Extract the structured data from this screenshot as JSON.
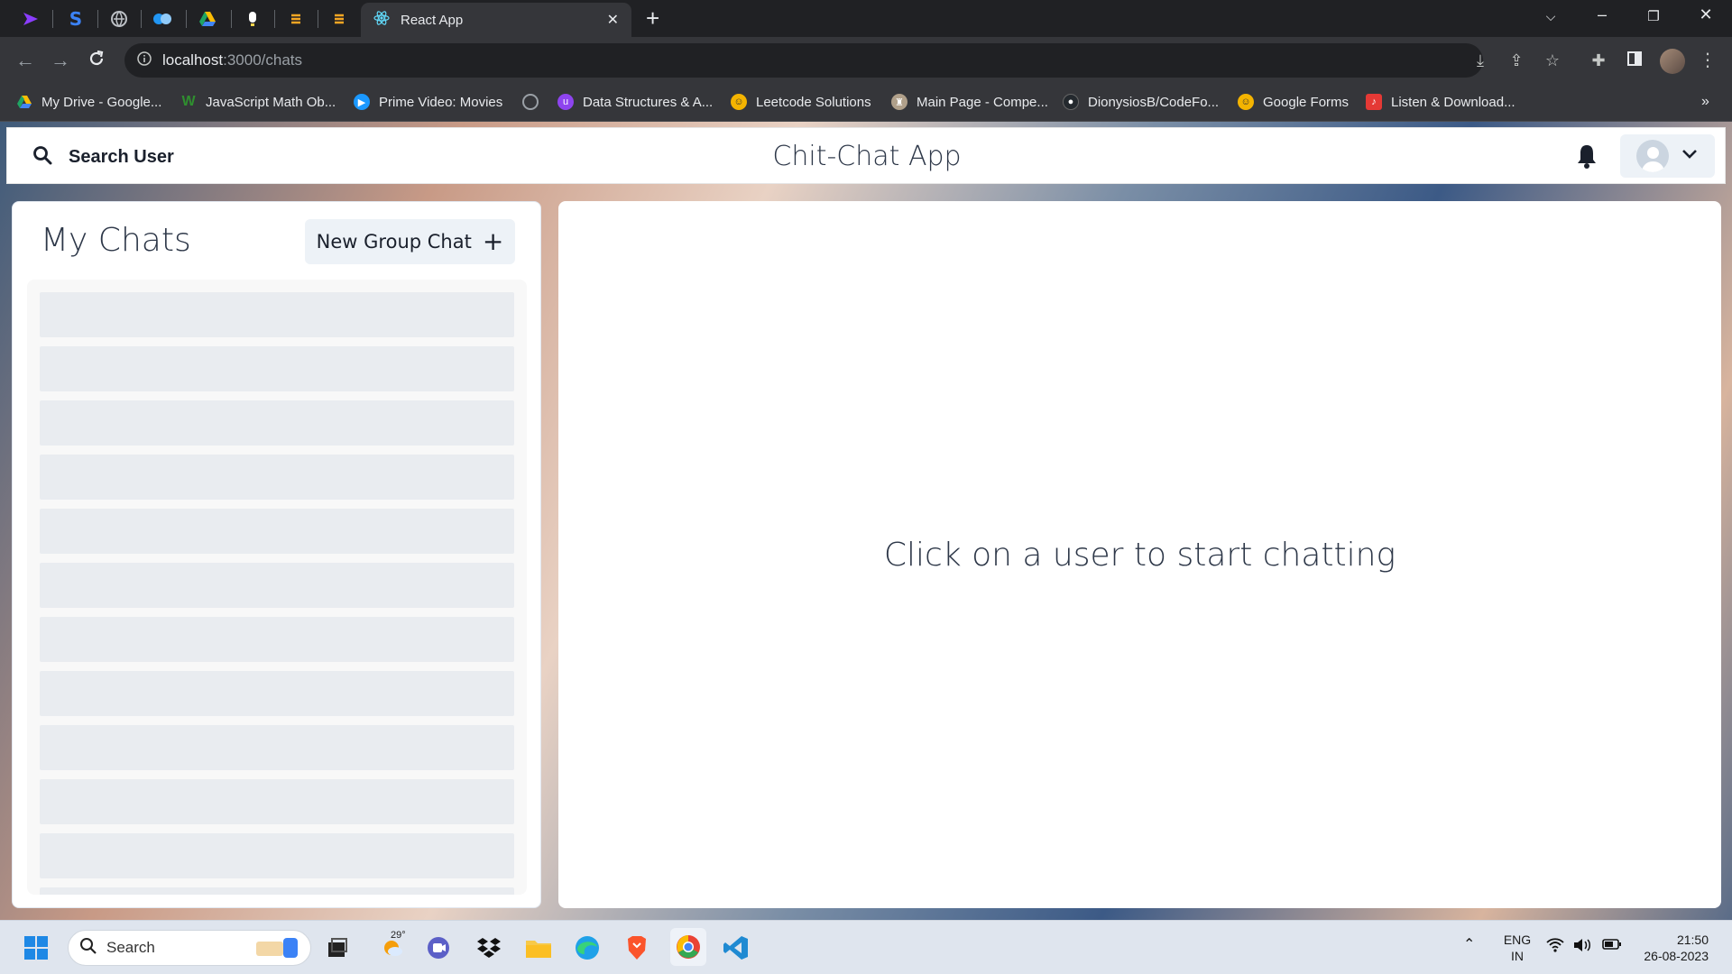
{
  "browser": {
    "active_tab_title": "React App",
    "url_host": "localhost",
    "url_path": ":3000/chats",
    "bookmarks": [
      {
        "label": "My Drive - Google...",
        "color": "#34a853"
      },
      {
        "label": "JavaScript Math Ob...",
        "color": "#2f8f2f"
      },
      {
        "label": "Prime Video: Movies",
        "color": "#1a98ff"
      },
      {
        "label": "",
        "color": "#9aa0a6"
      },
      {
        "label": "Data Structures & A...",
        "color": "#8e44ef"
      },
      {
        "label": "Leetcode Solutions",
        "color": "#f4b400"
      },
      {
        "label": "Main Page - Compe...",
        "color": "#b0a08a"
      },
      {
        "label": "DionysiosB/CodeFo...",
        "color": "#24292e"
      },
      {
        "label": "Google Forms",
        "color": "#f4b400"
      },
      {
        "label": "Listen & Download...",
        "color": "#e53935"
      }
    ]
  },
  "app": {
    "search_label": "Search User",
    "title": "Chit-Chat App",
    "my_chats_heading": "My Chats",
    "new_group_label": "New Group Chat",
    "empty_chat_hint": "Click on a user to start chatting"
  },
  "taskbar": {
    "search_label": "Search",
    "weather_temp": "29°",
    "lang_top": "ENG",
    "lang_bottom": "IN",
    "time": "21:50",
    "date": "26-08-2023"
  }
}
